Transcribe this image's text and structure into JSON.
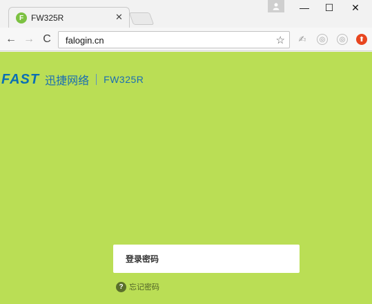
{
  "browser": {
    "tab": {
      "title": "FW325R",
      "favicon_letter": "F",
      "close_glyph": "✕"
    },
    "window_controls": {
      "minimize": "—",
      "maximize": "☐",
      "close": "✕"
    },
    "toolbar": {
      "back": "←",
      "forward": "→",
      "reload": "C",
      "url": "falogin.cn",
      "star": "☆"
    },
    "extensions": {
      "ext1": "✍",
      "ext2": "◎",
      "ext3": "◎",
      "ext4": "⬆"
    }
  },
  "page": {
    "brand": {
      "logo": "FAST",
      "company": "迅捷网络",
      "model": "FW325R"
    },
    "login": {
      "password_placeholder": "登录密码",
      "forgot_label": "忘记密码",
      "forgot_icon": "?"
    }
  },
  "colors": {
    "page_background": "#bade55",
    "brand_blue": "#1a6db3",
    "favicon_green": "#7cc142",
    "ext_red": "#e8461f"
  }
}
